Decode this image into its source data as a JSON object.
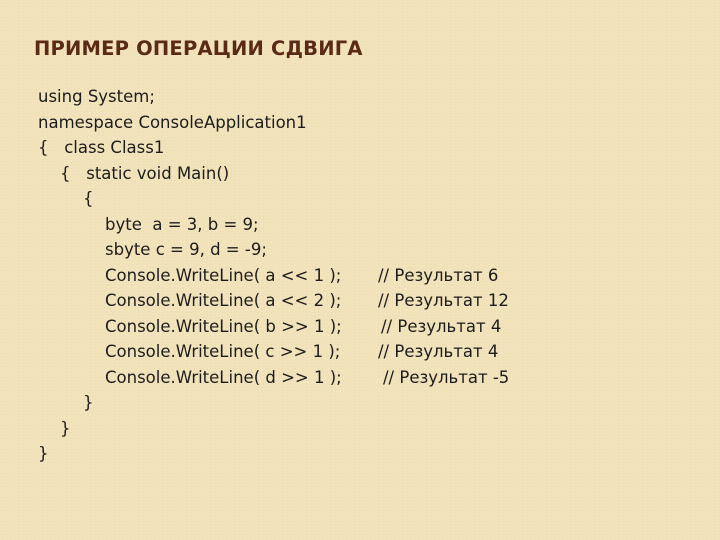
{
  "slide": {
    "title": "ПРИМЕР ОПЕРАЦИИ СДВИГА",
    "code_lines": [
      {
        "text": "using System;",
        "comment": ""
      },
      {
        "text": "namespace ConsoleApplication1",
        "comment": ""
      },
      {
        "text": "{   class Class1",
        "comment": ""
      },
      {
        "text": "{   static void Main()",
        "comment": ""
      },
      {
        "text": "{",
        "comment": ""
      },
      {
        "text": "byte  a = 3, b = 9;",
        "comment": ""
      },
      {
        "text": "sbyte c = 9, d = -9;",
        "comment": ""
      },
      {
        "text": "Console.WriteLine( a << 1 );",
        "comment": "// Результат 6"
      },
      {
        "text": "Console.WriteLine( a << 2 );",
        "comment": "// Результат 12"
      },
      {
        "text": "Console.WriteLine( b >> 1 );",
        "comment": "// Результат 4"
      },
      {
        "text": "Console.WriteLine( c >> 1 );",
        "comment": "// Результат 4"
      },
      {
        "text": "Console.WriteLine( d >> 1 );",
        "comment": "// Результат -5"
      },
      {
        "text": "}",
        "comment": ""
      },
      {
        "text": "}",
        "comment": ""
      },
      {
        "text": "}",
        "comment": ""
      }
    ]
  }
}
